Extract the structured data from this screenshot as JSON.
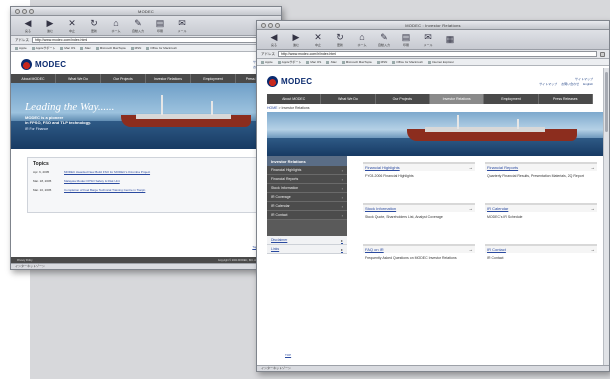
{
  "back_window": {
    "title": "MODEC",
    "toolbar": [
      {
        "icon": "back-icon",
        "glyph": "◀",
        "label": "戻る"
      },
      {
        "icon": "forward-icon",
        "glyph": "▶",
        "label": "進む"
      },
      {
        "icon": "stop-icon",
        "glyph": "✕",
        "label": "中止"
      },
      {
        "icon": "reload-icon",
        "glyph": "↻",
        "label": "更新"
      },
      {
        "icon": "home-icon",
        "glyph": "⌂",
        "label": "ホーム"
      },
      {
        "icon": "autofill-icon",
        "glyph": "✎",
        "label": "自動入力"
      },
      {
        "icon": "print-icon",
        "glyph": "▤",
        "label": "印刷"
      },
      {
        "icon": "mail-icon",
        "glyph": "✉",
        "label": "メール"
      }
    ],
    "address_label": "アドレス",
    "url": "http://www.modec.com/index.html",
    "favorites": [
      "Apple",
      "Appleサポート",
      "Mac OS",
      ".Mac",
      "Microsoft MacTopia",
      "MSN",
      "Office for Macintosh"
    ],
    "site": {
      "logo_text": "MODEC",
      "top_links": [
        "サイトマップ",
        "お問い合わせ",
        "English"
      ],
      "nav": [
        "About MODEC",
        "What We Do",
        "Our Projects",
        "Investor Relations",
        "Employment",
        "Press Releases"
      ],
      "hero": {
        "headline": "Leading the Way......",
        "subline1": "MODEC is a pioneer",
        "subline2": "in FPSO, FSO and TLP technology.",
        "link": "IR For Finance"
      },
      "topics_heading": "Topics",
      "topics": [
        {
          "date": "Apr. 6, 2005",
          "text": "MODEC Awarded New Build FSO for MODEC's Kizomba Project"
        },
        {
          "date": "Mar. 18, 2005",
          "text": "Malaysia Modec FPSO Safety & Risk Unit"
        },
        {
          "date": "Mar. 10, 2005",
          "text": "Completion of Fuel Barge Technical Training Centre in Tianjin"
        }
      ],
      "more_link": "Topics Archives",
      "copyright": "Copyright © 2004 MODEC, INC. All rights reserved.",
      "privacy": "Privacy Policy"
    },
    "status": "インターネットゾーン"
  },
  "front_window": {
    "title": "MODEC : Investor Relations",
    "toolbar": [
      {
        "icon": "back-icon",
        "glyph": "◀",
        "label": "戻る"
      },
      {
        "icon": "forward-icon",
        "glyph": "▶",
        "label": "進む"
      },
      {
        "icon": "stop-icon",
        "glyph": "✕",
        "label": "中止"
      },
      {
        "icon": "reload-icon",
        "glyph": "↻",
        "label": "更新"
      },
      {
        "icon": "home-icon",
        "glyph": "⌂",
        "label": "ホーム"
      },
      {
        "icon": "autofill-icon",
        "glyph": "✎",
        "label": "自動入力"
      },
      {
        "icon": "print-icon",
        "glyph": "▤",
        "label": "印刷"
      },
      {
        "icon": "mail-icon",
        "glyph": "✉",
        "label": "メール"
      },
      {
        "icon": "tabs-icon",
        "glyph": "▦",
        "label": ""
      }
    ],
    "address_label": "アドレス",
    "url": "http://www.modec.com/ir/index.html",
    "favorites": [
      "Apple",
      "Appleサポート",
      "Mac OS",
      ".Mac",
      "Microsoft MacTopia",
      "MSN",
      "Office for Macintosh",
      "Internet Explorer"
    ],
    "site": {
      "logo_text": "MODEC",
      "top_links": [
        "サイトマップ",
        "ENGLISH"
      ],
      "utility_links": [
        "サイトマップ",
        "お問い合わせ",
        "English"
      ],
      "nav": [
        "About MODEC",
        "What We Do",
        "Our Projects",
        "Investor Relations",
        "Employment",
        "Press Releases"
      ],
      "active_nav": "Investor Relations",
      "breadcrumb_home": "HOME",
      "breadcrumb_current": "Investor Relations",
      "sidebar_heading": "Investor Relations",
      "sidebar_items": [
        "Financial Highlights",
        "Financial Reports",
        "Stock Information",
        "IR Coverage",
        "IR Calendar",
        "IR Contact"
      ],
      "sidebar_links": [
        "Disclaimer",
        "Links"
      ],
      "cards": [
        {
          "title": "Financial Highlights",
          "body": "FY03-2006 Financial Highlights"
        },
        {
          "title": "Financial Reports",
          "body": "Quarterly Financial Results, Presentation Materials, 2Q Report"
        },
        {
          "title": "Stock Information",
          "body": "Stock Quote, Shareholders List, Analyst Coverage"
        },
        {
          "title": "IR Calendar",
          "body": "MODEC's IR Schedule"
        },
        {
          "title": "FAQ on IR",
          "body": "Frequently Asked Questions on MODEC Investor Relations"
        },
        {
          "title": "IR Contact",
          "body": "IR Contact"
        }
      ],
      "footer_link": "TOP"
    },
    "status": "インターネットゾーン"
  },
  "colors": {
    "nav_bg": "#4a4a4a",
    "nav_active": "#8a8a8a",
    "link": "#2a4aa0",
    "brand_navy": "#0a2a6e",
    "brand_red": "#c8281e",
    "sidebar_head": "#5a6d86"
  }
}
